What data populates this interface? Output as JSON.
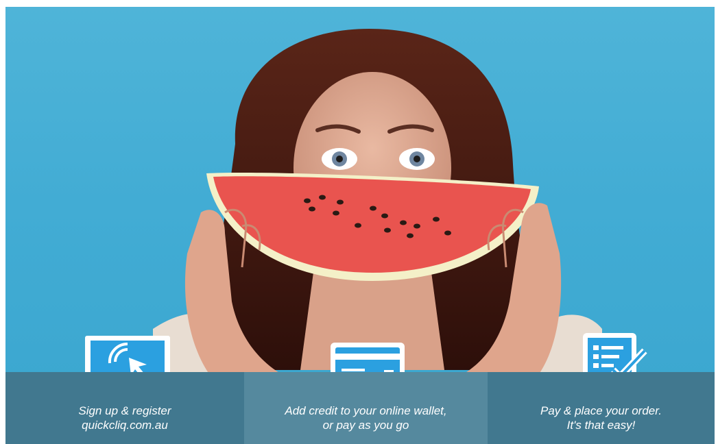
{
  "brand": {
    "site": "quickcliq.com.au"
  },
  "steps": [
    {
      "icon": "laptop-cursor-icon",
      "line1": "Sign up & register",
      "line2": "quickcliq.com.au"
    },
    {
      "icon": "credit-card-icon",
      "line1": "Add credit to your online wallet,",
      "line2": "or pay as you go"
    },
    {
      "icon": "tablet-checklist-icon",
      "line1": "Pay & place your order.",
      "line2": "It's that easy!"
    }
  ],
  "colors": {
    "background": "#44acd4",
    "panel_dark": "#41788f",
    "panel_light": "#55899e",
    "icon_blue": "#2ba0e0"
  }
}
